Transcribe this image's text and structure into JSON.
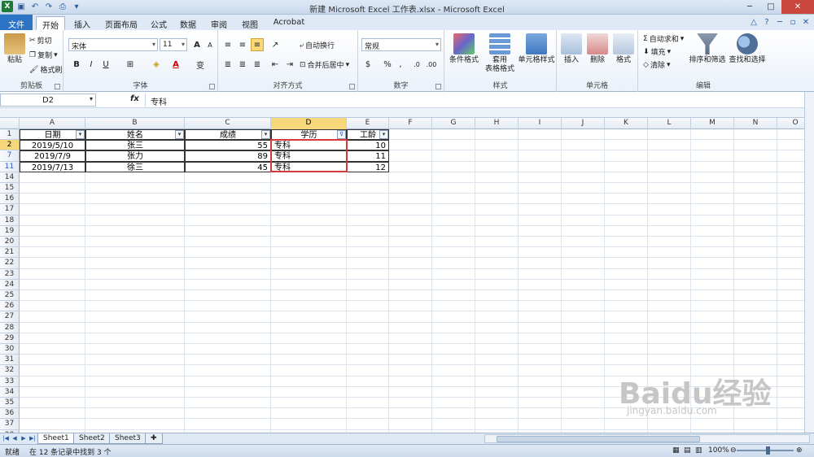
{
  "window": {
    "title": "新建 Microsoft Excel 工作表.xlsx - Microsoft Excel",
    "app_icon": "X"
  },
  "ribbon_tabs": [
    "文件",
    "开始",
    "插入",
    "页面布局",
    "公式",
    "数据",
    "审阅",
    "视图",
    "Acrobat"
  ],
  "ribbon": {
    "clipboard": {
      "paste": "粘贴",
      "cut": "剪切",
      "copy": "复制",
      "format_painter": "格式刷",
      "label": "剪贴板"
    },
    "font": {
      "name": "宋体",
      "size": "11",
      "bold": "B",
      "italic": "I",
      "underline": "U",
      "grow": "A",
      "shrink": "A",
      "font_color": "A",
      "phonetic": "变",
      "label": "字体"
    },
    "alignment": {
      "wrap": "自动换行",
      "merge": "合并后居中",
      "label": "对齐方式"
    },
    "number": {
      "format": "常规",
      "percent": "%",
      "comma": ",",
      "label": "数字"
    },
    "styles": {
      "conditional": "条件格式",
      "table1": "套用",
      "table2": "表格格式",
      "cell_styles": "单元格样式",
      "label": "样式"
    },
    "cells": {
      "insert": "插入",
      "delete": "删除",
      "format": "格式",
      "label": "单元格"
    },
    "editing": {
      "autosum": "自动求和",
      "autosum_symbol": "Σ",
      "fill": "填充",
      "clear": "清除",
      "sort": "排序和筛选",
      "find": "查找和选择",
      "label": "编辑"
    }
  },
  "formula_bar": {
    "name_box": "D2",
    "fx": "fx",
    "content": "专科"
  },
  "columns": [
    "A",
    "B",
    "C",
    "D",
    "E",
    "F",
    "G",
    "H",
    "I",
    "J",
    "K",
    "L",
    "M",
    "N",
    "O"
  ],
  "rows": [
    "1",
    "2",
    "7",
    "11",
    "14",
    "15",
    "16",
    "17",
    "18",
    "19",
    "20",
    "21",
    "22",
    "23",
    "24",
    "25",
    "26",
    "27",
    "28",
    "29",
    "30",
    "31",
    "32",
    "33",
    "34",
    "35",
    "36",
    "37",
    "38"
  ],
  "table": {
    "headers": [
      "日期",
      "姓名",
      "成绩",
      "学历",
      "工龄"
    ],
    "rows": [
      [
        "2019/5/10",
        "张三",
        "55",
        "专科",
        "10"
      ],
      [
        "2019/7/9",
        "张力",
        "89",
        "专科",
        "11"
      ],
      [
        "2019/7/13",
        "徐三",
        "45",
        "专科",
        "12"
      ]
    ]
  },
  "sheets": [
    "Sheet1",
    "Sheet2",
    "Sheet3"
  ],
  "status": {
    "ready": "就绪",
    "filter_info": "在 12 条记录中找到 3 个",
    "zoom": "100%",
    "zoom_level": 0.55
  },
  "watermark": {
    "brand": "Baidu经验",
    "url": "jingyan.baidu.com"
  }
}
